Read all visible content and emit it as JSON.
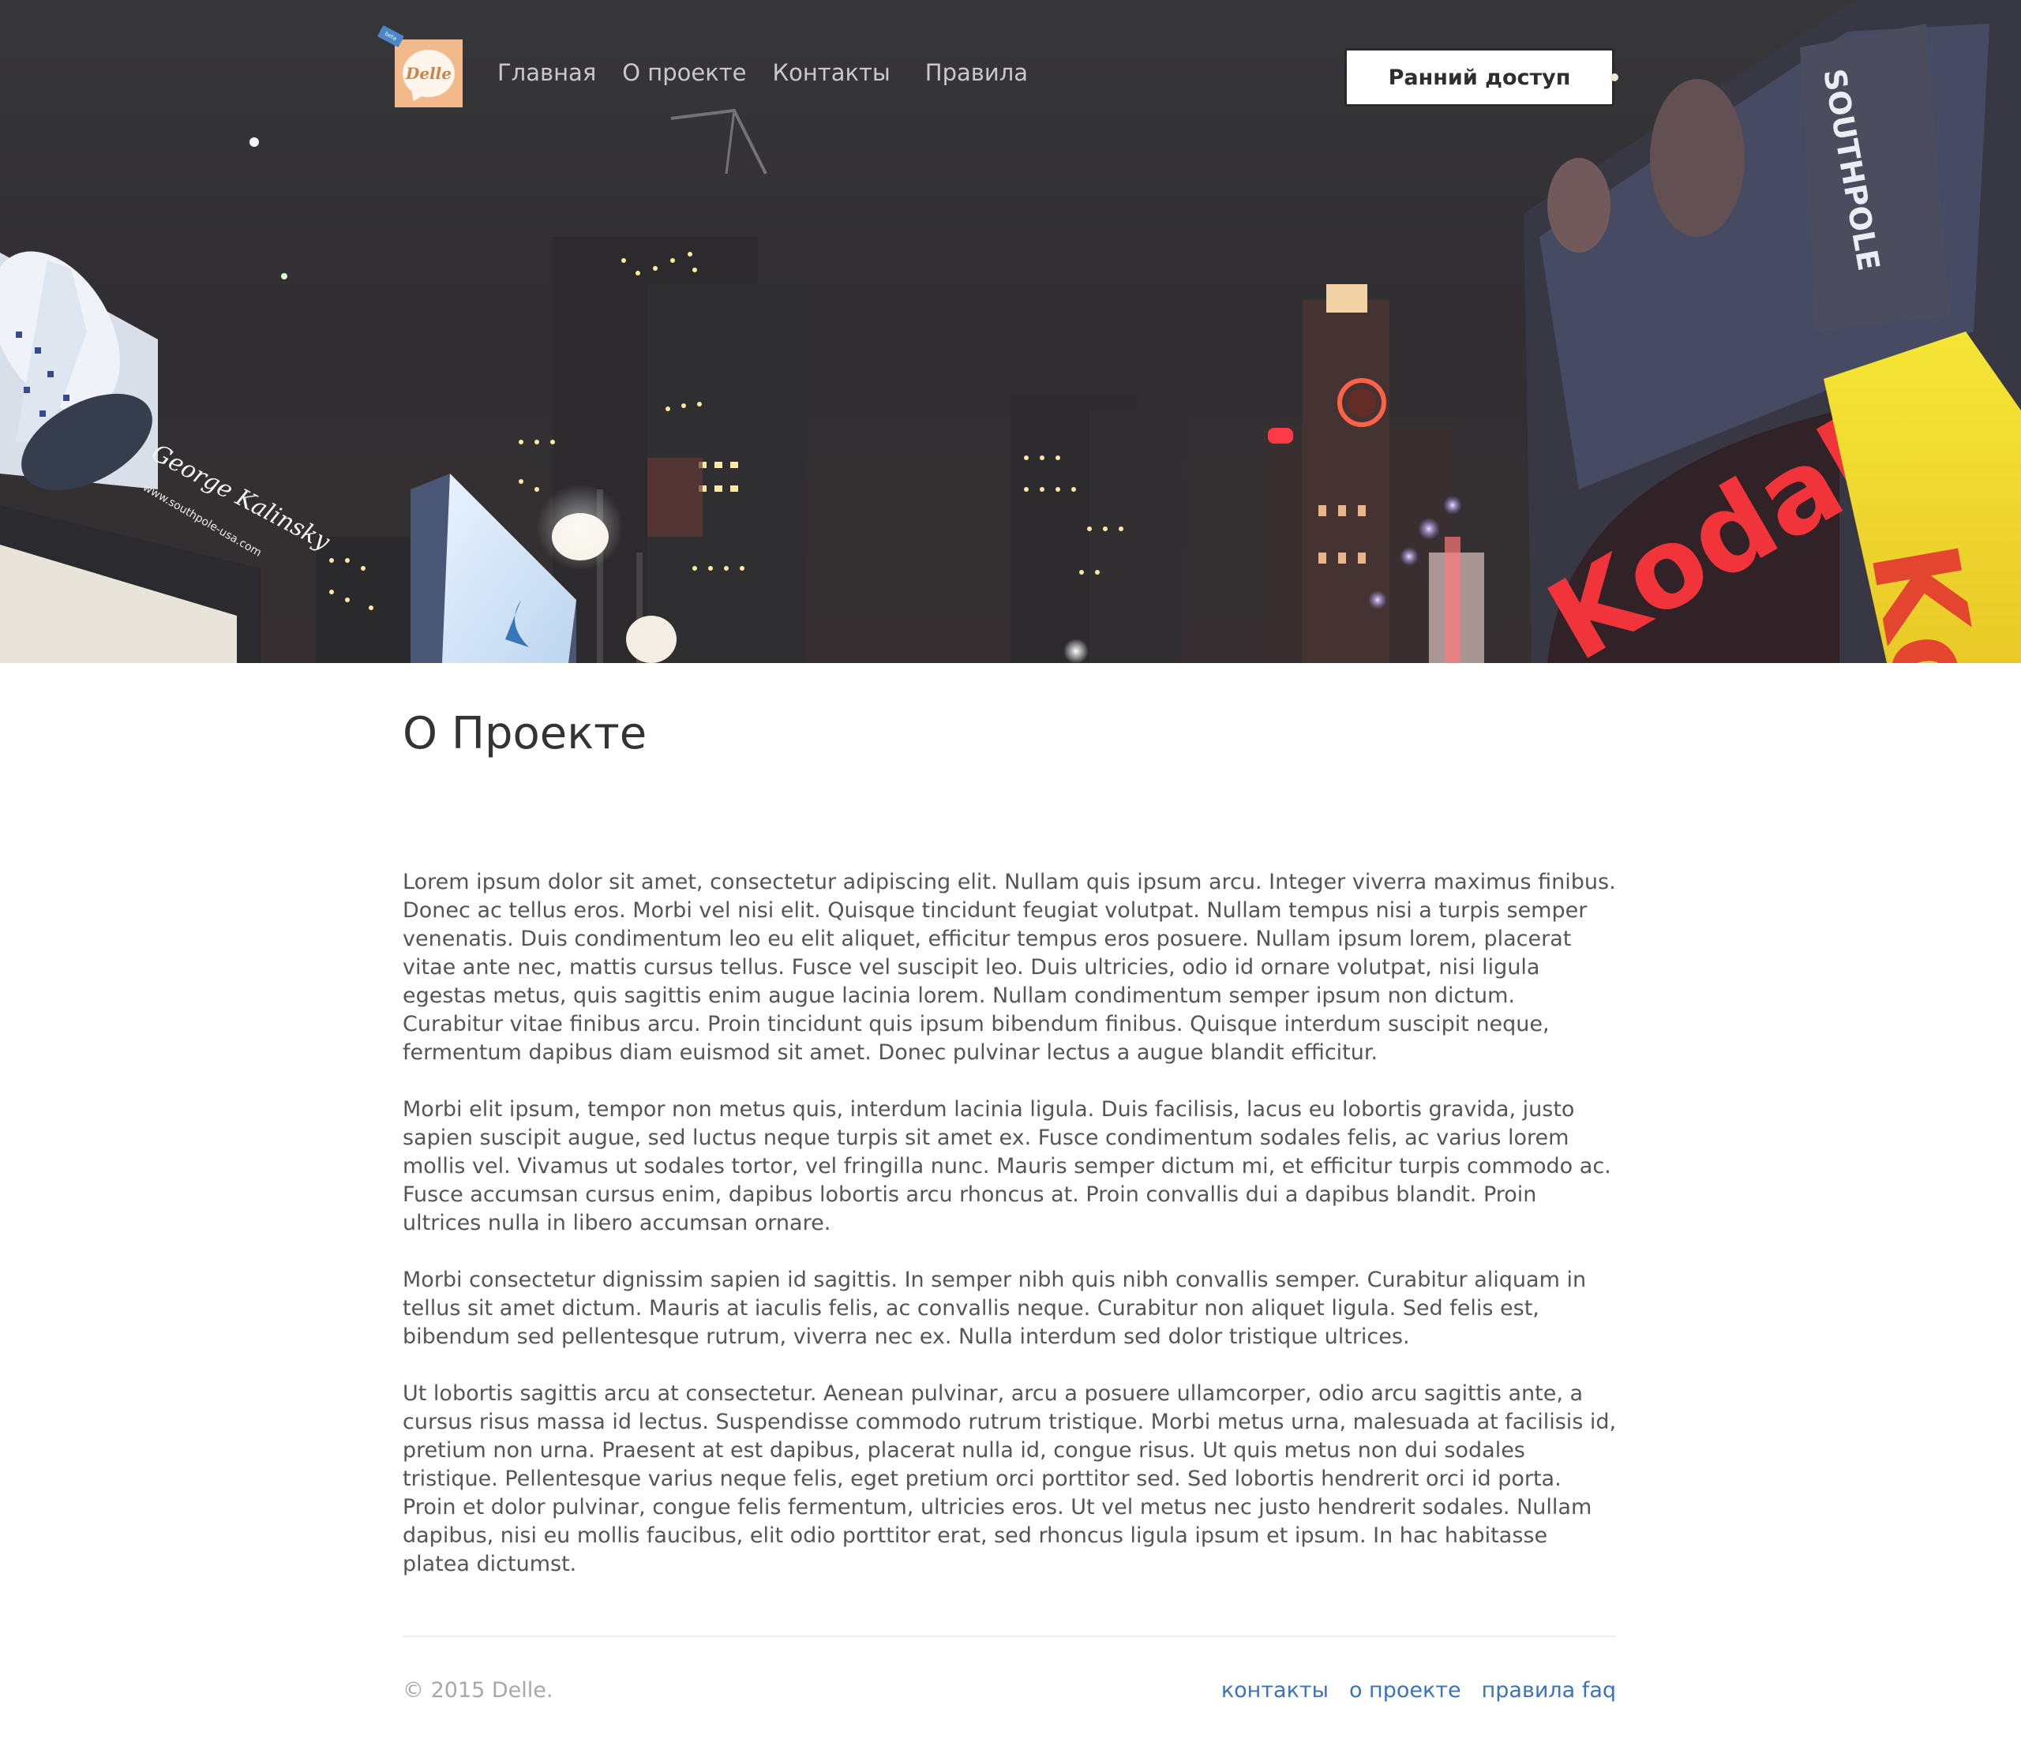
{
  "header": {
    "logo_text": "Delle",
    "logo_tag": "beta",
    "nav": [
      "Главная",
      "О проекте",
      "Контакты",
      "Правила"
    ],
    "cta_label": "Ранний доступ"
  },
  "hero": {
    "billboard_brand": "Kodak",
    "billboard_brand_partial": "Ko",
    "billboard_side": "SOUTHPOLE",
    "billboard_url": "www.southpole-usa.com",
    "billboard_signature": "George Kalinsky"
  },
  "main": {
    "title": "О Проекте",
    "paragraphs": [
      "Lorem ipsum dolor sit amet, consectetur adipiscing elit. Nullam quis ipsum arcu. Integer viverra maximus finibus. Donec ac tellus eros. Morbi vel nisi elit. Quisque tincidunt feugiat volutpat. Nullam tempus nisi a turpis semper venenatis. Duis condimentum leo eu elit aliquet, efficitur tempus eros posuere. Nullam ipsum lorem, placerat vitae ante nec, mattis cursus tellus. Fusce vel suscipit leo. Duis ultricies, odio id ornare volutpat, nisi ligula egestas metus, quis sagittis enim augue lacinia lorem. Nullam condimentum semper ipsum non dictum. Curabitur vitae finibus arcu. Proin tincidunt quis ipsum bibendum finibus. Quisque interdum suscipit neque, fermentum dapibus diam euismod sit amet. Donec pulvinar lectus a augue blandit efficitur.",
      "Morbi elit ipsum, tempor non metus quis, interdum lacinia ligula. Duis facilisis, lacus eu lobortis gravida, justo sapien suscipit augue, sed luctus neque turpis sit amet ex. Fusce condimentum sodales felis, ac varius lorem mollis vel. Vivamus ut sodales tortor, vel fringilla nunc. Mauris semper dictum mi, et efficitur turpis commodo ac. Fusce accumsan cursus enim, dapibus lobortis arcu rhoncus at. Proin convallis dui a dapibus blandit. Proin ultrices nulla in libero accumsan ornare.",
      "Morbi consectetur dignissim sapien id sagittis. In semper nibh quis nibh convallis semper. Curabitur aliquam in tellus sit amet dictum. Mauris at iaculis felis, ac convallis neque. Curabitur non aliquet ligula. Sed felis est, bibendum sed pellentesque rutrum, viverra nec ex. Nulla interdum sed dolor tristique ultrices.",
      "Ut lobortis sagittis arcu at consectetur. Aenean pulvinar, arcu a posuere ullamcorper, odio arcu sagittis ante, a cursus risus massa id lectus. Suspendisse commodo rutrum tristique. Morbi metus urna, malesuada at facilisis id, pretium non urna. Praesent at est dapibus, placerat nulla id, congue risus. Ut quis metus non dui sodales tristique. Pellentesque varius neque felis, eget pretium orci porttitor sed. Sed lobortis hendrerit orci id porta. Proin et dolor pulvinar, congue felis fermentum, ultricies eros. Ut vel metus nec justo hendrerit sodales. Nullam dapibus, nisi eu mollis faucibus, elit odio porttitor erat, sed rhoncus ligula ipsum et ipsum. In hac habitasse platea dictumst."
    ]
  },
  "footer": {
    "copyright": "© 2015 Delle.",
    "links": [
      "контакты",
      "о проекте",
      "правила faq"
    ]
  },
  "colors": {
    "logo_bg": "#f4b98a",
    "link": "#3a73b8",
    "text": "#555555",
    "heading": "#333333"
  }
}
